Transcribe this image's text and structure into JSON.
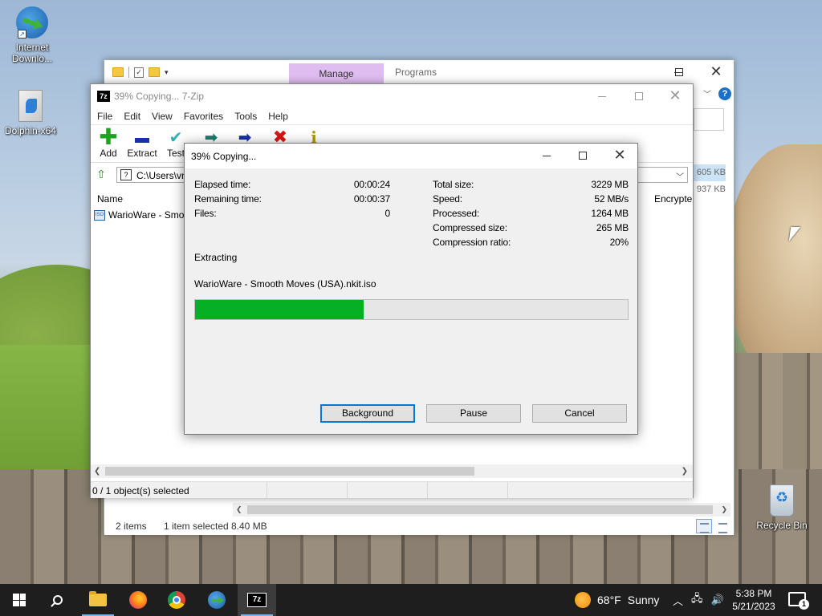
{
  "desktop": {
    "icons": [
      {
        "label": "Internet Downlo..."
      },
      {
        "label": "Dolphin-x64"
      },
      {
        "label": "Recycle Bin"
      }
    ]
  },
  "explorer": {
    "manage_tab": "Manage",
    "programs_tab": "Programs",
    "sizes": [
      "605 KB",
      "937 KB"
    ],
    "status": {
      "items": "2 items",
      "selected": "1 item selected",
      "size": "8.40 MB"
    }
  },
  "sevenzip": {
    "title": "39% Copying... 7-Zip",
    "app_icon": "7z",
    "menu": [
      "File",
      "Edit",
      "View",
      "Favorites",
      "Tools",
      "Help"
    ],
    "toolbar": {
      "add": "Add",
      "extract": "Extract",
      "test": "Test"
    },
    "address_path": "C:\\Users\\vn",
    "columns": {
      "name": "Name",
      "encrypted": "Encrypte"
    },
    "file_row": "WarioWare - Smoo",
    "status": "0 / 1 object(s) selected"
  },
  "dialog": {
    "title": "39% Copying...",
    "left_stats": [
      {
        "label": "Elapsed time:",
        "value": "00:00:24"
      },
      {
        "label": "Remaining time:",
        "value": "00:00:37"
      },
      {
        "label": "Files:",
        "value": "0"
      }
    ],
    "right_stats": [
      {
        "label": "Total size:",
        "value": "3229 MB"
      },
      {
        "label": "Speed:",
        "value": "52 MB/s"
      },
      {
        "label": "Processed:",
        "value": "1264 MB"
      },
      {
        "label": "Compressed size:",
        "value": "265 MB"
      },
      {
        "label": "Compression ratio:",
        "value": "20%"
      }
    ],
    "operation": "Extracting",
    "current_file": "WarioWare - Smooth Moves (USA).nkit.iso",
    "progress_percent": 39,
    "buttons": {
      "background": "Background",
      "pause": "Pause",
      "cancel": "Cancel"
    }
  },
  "taskbar": {
    "weather": {
      "temp": "68°F",
      "condition": "Sunny"
    },
    "clock": {
      "time": "5:38 PM",
      "date": "5/21/2023"
    },
    "notifications": "1"
  },
  "colors": {
    "progress_fill": "#06b025",
    "manage_tab": "#e0bdf0",
    "default_button_border": "#0078d7",
    "taskbar": "#1e1e1e"
  }
}
